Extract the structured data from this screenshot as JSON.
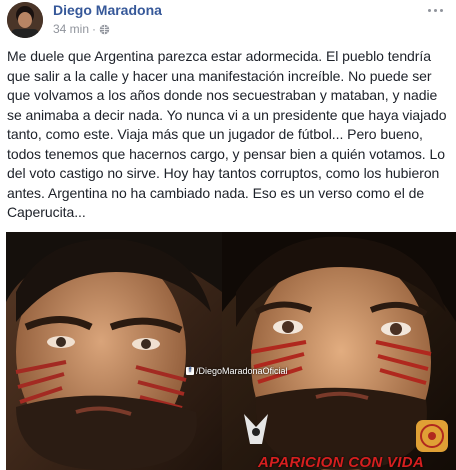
{
  "post": {
    "author": "Diego Maradona",
    "timestamp": "34 min",
    "separator": "·",
    "privacy_icon": "globe-icon",
    "more_icon": "more-options-icon",
    "text": "Me duele que Argentina parezca estar adormecida. El pueblo tendría\nque salir a la calle y hacer una manifestación increíble. No puede ser\nque volvamos a los años donde nos secuestraban y mataban, y nadie\nse animaba a decir nada. Yo nunca vi a un presidente que haya viajado\ntanto, como este. Viaja más que un jugador de fútbol... Pero bueno,\ntodos tenemos que hacernos cargo, y pensar bien a quién votamos. Lo\ndel voto castigo no sirve. Hoy hay tantos corruptos, como los hubieron\nantes. Argentina no ha cambiado nada. Eso es un verso como el de\nCaperucita..."
  },
  "image": {
    "watermark": "/DiegoMaradonaOficial",
    "caption": "APARICION CON VIDA"
  },
  "colors": {
    "author_blue": "#365899",
    "meta_gray": "#90949c",
    "text": "#1d2129",
    "caption_red": "#d61f1f"
  }
}
